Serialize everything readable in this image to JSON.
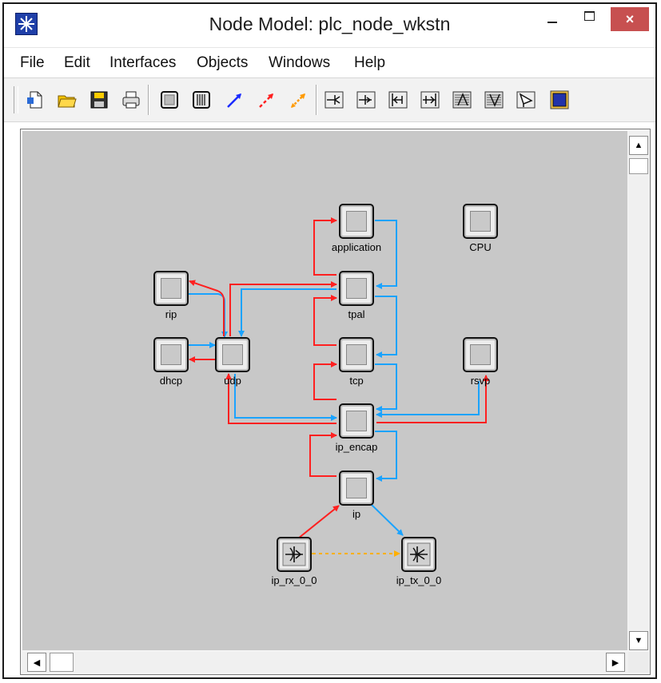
{
  "window": {
    "title": "Node Model: plc_node_wkstn",
    "close_label": "×"
  },
  "menu": {
    "items": [
      "File",
      "Edit",
      "Interfaces",
      "Objects",
      "Windows",
      "Help"
    ]
  },
  "toolbar": {
    "buttons": [
      "new-document",
      "open-folder",
      "save-disk",
      "print",
      "create-queue",
      "create-processor",
      "stream-line",
      "statistic-line",
      "logical-tap",
      "point-to-point-transmitter",
      "point-to-point-receiver",
      "bus-transmitter",
      "bus-receiver",
      "radio-transmitter",
      "radio-receiver",
      "antenna",
      "external-system"
    ]
  },
  "nodes": [
    {
      "id": "application",
      "label": "application"
    },
    {
      "id": "cpu",
      "label": "CPU"
    },
    {
      "id": "rip",
      "label": "rip"
    },
    {
      "id": "tpal",
      "label": "tpal"
    },
    {
      "id": "dhcp",
      "label": "dhcp"
    },
    {
      "id": "udp",
      "label": "udp"
    },
    {
      "id": "tcp",
      "label": "tcp"
    },
    {
      "id": "rsvp",
      "label": "rsvp"
    },
    {
      "id": "ip_encap",
      "label": "ip_encap"
    },
    {
      "id": "ip",
      "label": "ip"
    },
    {
      "id": "ip_rx_0_0",
      "label": "ip_rx_0_0"
    },
    {
      "id": "ip_tx_0_0",
      "label": "ip_tx_0_0"
    }
  ],
  "colors": {
    "stream_down": "#1aa3ff",
    "stream_up": "#ff2020",
    "stat_wire": "#ffb000",
    "canvas": "#c8c8c8"
  },
  "scrollbars": {
    "up_arrow": "▲",
    "down_arrow": "▼",
    "left_arrow": "◀",
    "right_arrow": "▶"
  }
}
